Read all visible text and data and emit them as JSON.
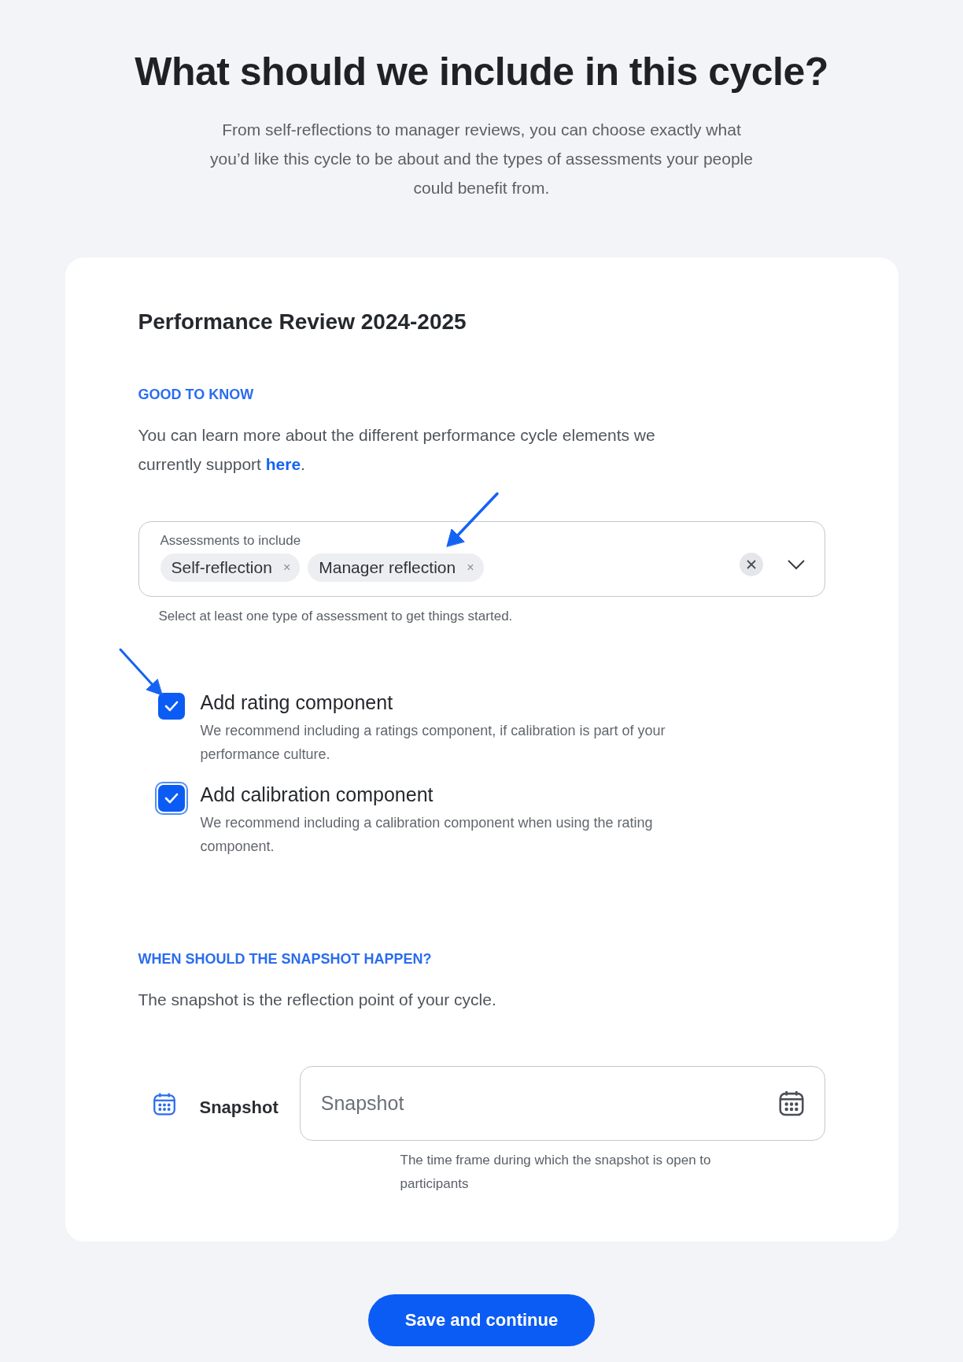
{
  "heading": "What should we include in this cycle?",
  "intro": "From self-reflections to manager reviews, you can choose exactly what you’d like this cycle to be about and the types of assessments your people could benefit from.",
  "card": {
    "title": "Performance Review 2024-2025",
    "good_to_know": {
      "heading": "GOOD TO KNOW",
      "text": "You can learn more about the different performance cycle elements we currently support ",
      "link": "here",
      "after": "."
    },
    "assessments": {
      "label": "Assessments to include",
      "chips": [
        {
          "label": "Self-reflection",
          "remove": "×"
        },
        {
          "label": "Manager reflection",
          "remove": "×"
        }
      ],
      "helper": "Select at least one type of assessment to get things started."
    },
    "options": [
      {
        "label": "Add rating component",
        "description": "We recommend including a ratings component, if calibration is part of your performance culture.",
        "checked": true,
        "focused": false
      },
      {
        "label": "Add calibration component",
        "description": "We recommend including a calibration component when using the rating component.",
        "checked": true,
        "focused": true
      }
    ],
    "snapshot": {
      "heading": "WHEN SHOULD THE SNAPSHOT HAPPEN?",
      "text": "The snapshot is the reflection point of your cycle.",
      "label": "Snapshot",
      "placeholder": "Snapshot",
      "helper": "The time frame during which the snapshot is open to participants"
    }
  },
  "primary_button": "Save and continue"
}
